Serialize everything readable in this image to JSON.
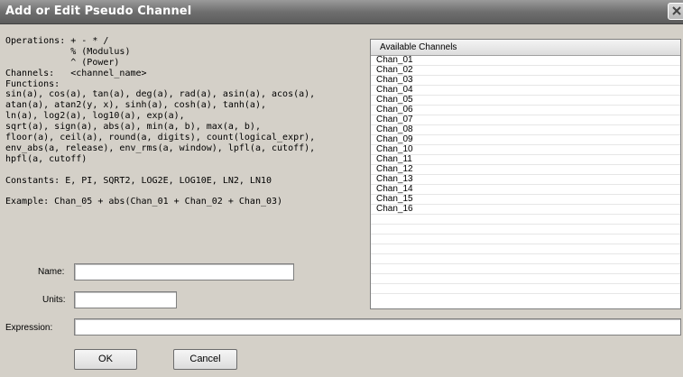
{
  "window": {
    "title": "Add or Edit Pseudo Channel"
  },
  "help_lines": [
    "Operations: + - * /",
    "            % (Modulus)",
    "            ^ (Power)",
    "Channels:   <channel_name>",
    "Functions:",
    "sin(a), cos(a), tan(a), deg(a), rad(a), asin(a), acos(a),",
    "atan(a), atan2(y, x), sinh(a), cosh(a), tanh(a),",
    "ln(a), log2(a), log10(a), exp(a),",
    "sqrt(a), sign(a), abs(a), min(a, b), max(a, b),",
    "floor(a), ceil(a), round(a, digits), count(logical_expr),",
    "env_abs(a, release), env_rms(a, window), lpfl(a, cutoff),",
    "hpfl(a, cutoff)",
    "",
    "Constants: E, PI, SQRT2, LOG2E, LOG10E, LN2, LN10",
    "",
    "Example: Chan_05 + abs(Chan_01 + Chan_02 + Chan_03)"
  ],
  "fields": {
    "name_label": "Name:",
    "name_value": "",
    "units_label": "Units:",
    "units_value": "",
    "expression_label": "Expression:",
    "expression_value": ""
  },
  "channels": {
    "header": "Available Channels",
    "items": [
      "Chan_01",
      "Chan_02",
      "Chan_03",
      "Chan_04",
      "Chan_05",
      "Chan_06",
      "Chan_07",
      "Chan_08",
      "Chan_09",
      "Chan_10",
      "Chan_11",
      "Chan_12",
      "Chan_13",
      "Chan_14",
      "Chan_15",
      "Chan_16"
    ]
  },
  "buttons": {
    "ok": "OK",
    "cancel": "Cancel"
  }
}
